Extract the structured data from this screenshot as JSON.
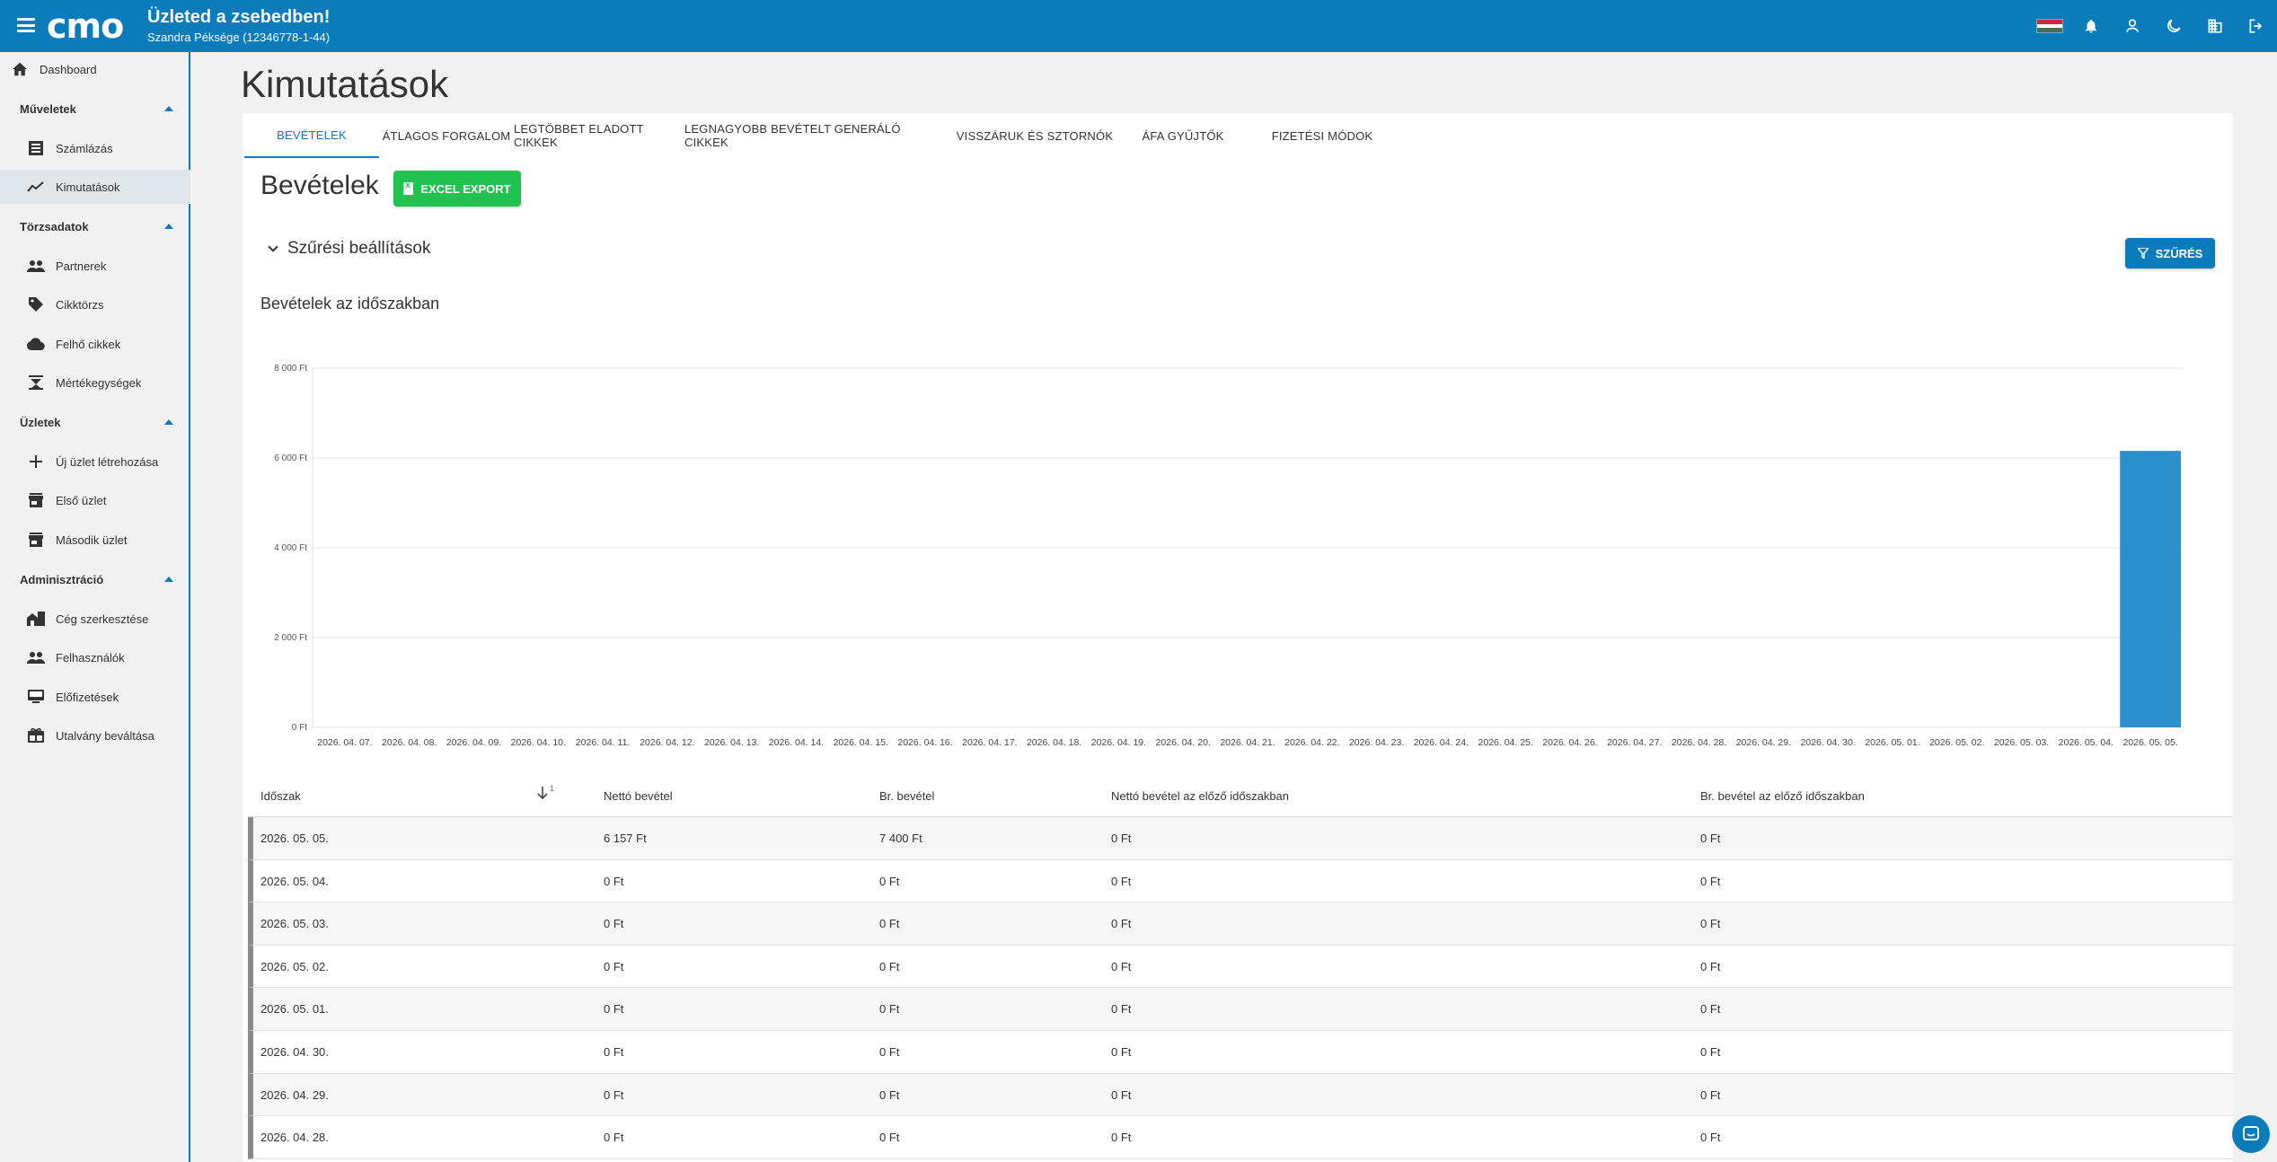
{
  "app": {
    "logo": "cmo",
    "title": "Üzleted a zsebedben!",
    "subtitle": "Szandra Péksége (12346778-1-44)"
  },
  "topbar_icons": [
    "hungarian-flag-icon",
    "bell-icon",
    "user-icon",
    "moon-icon",
    "building-icon",
    "logout-icon"
  ],
  "colors": {
    "brand": "#0a7bbb",
    "excel": "#21c250",
    "bar": "#2a8fcb"
  },
  "sidebar": {
    "dashboard": "Dashboard",
    "sections": [
      {
        "label": "Műveletek",
        "items": [
          "Számlázás",
          "Kimutatások"
        ]
      },
      {
        "label": "Törzsadatok",
        "items": [
          "Partnerek",
          "Cikktörzs",
          "Felhő cikkek",
          "Mértékegységek"
        ]
      },
      {
        "label": "Üzletek",
        "items": [
          "Új üzlet létrehozása",
          "Első üzlet",
          "Második üzlet"
        ]
      },
      {
        "label": "Adminisztráció",
        "items": [
          "Cég szerkesztése",
          "Felhasználók",
          "Előfizetések",
          "Utalvány beváltása"
        ]
      }
    ],
    "active_item": "Kimutatások"
  },
  "page": {
    "title": "Kimutatások",
    "tabs": [
      "BEVÉTELEK",
      "ÁTLAGOS FORGALOM",
      "LEGTÖBBET ELADOTT CIKKEK",
      "LEGNAGYOBB BEVÉTELT GENERÁLÓ CIKKEK",
      "VISSZÁRUK ÉS SZTORNÓK",
      "ÁFA GYŰJTŐK",
      "FIZETÉSI MÓDOK"
    ],
    "active_tab": "BEVÉTELEK",
    "section_title": "Bevételek",
    "excel_button": "EXCEL EXPORT",
    "filter_toggle": "Szűrési beállítások",
    "filter_button": "SZŰRÉS",
    "chart_title": "Bevételek az időszakban"
  },
  "chart_data": {
    "type": "bar",
    "title": "Bevételek az időszakban",
    "xlabel": "",
    "ylabel": "",
    "ylim": [
      0,
      8000
    ],
    "yticks": [
      0,
      2000,
      4000,
      6000,
      8000
    ],
    "ytick_labels": [
      "0 Ft",
      "2 000 Ft",
      "4 000 Ft",
      "6 000 Ft",
      "8 000 Ft"
    ],
    "grid": true,
    "categories": [
      "2026. 04. 07.",
      "2026. 04. 08.",
      "2026. 04. 09.",
      "2026. 04. 10.",
      "2026. 04. 11.",
      "2026. 04. 12.",
      "2026. 04. 13.",
      "2026. 04. 14.",
      "2026. 04. 15.",
      "2026. 04. 16.",
      "2026. 04. 17.",
      "2026. 04. 18.",
      "2026. 04. 19.",
      "2026. 04. 20.",
      "2026. 04. 21.",
      "2026. 04. 22.",
      "2026. 04. 23.",
      "2026. 04. 24.",
      "2026. 04. 25.",
      "2026. 04. 26.",
      "2026. 04. 27.",
      "2026. 04. 28.",
      "2026. 04. 29.",
      "2026. 04. 30.",
      "2026. 05. 01.",
      "2026. 05. 02.",
      "2026. 05. 03.",
      "2026. 05. 04.",
      "2026. 05. 05."
    ],
    "values": [
      0,
      0,
      0,
      0,
      0,
      0,
      0,
      0,
      0,
      0,
      0,
      0,
      0,
      0,
      0,
      0,
      0,
      0,
      0,
      0,
      0,
      0,
      0,
      0,
      0,
      0,
      0,
      0,
      6157
    ]
  },
  "table": {
    "headers": [
      "Időszak",
      "Nettó bevétel",
      "Br. bevétel",
      "Nettó bevétel az előző időszakban",
      "Br. bevétel az előző időszakban"
    ],
    "sort_index": "1",
    "rows": [
      [
        "2026. 05. 05.",
        "6 157 Ft",
        "7 400 Ft",
        "0 Ft",
        "0 Ft"
      ],
      [
        "2026. 05. 04.",
        "0 Ft",
        "0 Ft",
        "0 Ft",
        "0 Ft"
      ],
      [
        "2026. 05. 03.",
        "0 Ft",
        "0 Ft",
        "0 Ft",
        "0 Ft"
      ],
      [
        "2026. 05. 02.",
        "0 Ft",
        "0 Ft",
        "0 Ft",
        "0 Ft"
      ],
      [
        "2026. 05. 01.",
        "0 Ft",
        "0 Ft",
        "0 Ft",
        "0 Ft"
      ],
      [
        "2026. 04. 30.",
        "0 Ft",
        "0 Ft",
        "0 Ft",
        "0 Ft"
      ],
      [
        "2026. 04. 29.",
        "0 Ft",
        "0 Ft",
        "0 Ft",
        "0 Ft"
      ],
      [
        "2026. 04. 28.",
        "0 Ft",
        "0 Ft",
        "0 Ft",
        "0 Ft"
      ]
    ]
  }
}
